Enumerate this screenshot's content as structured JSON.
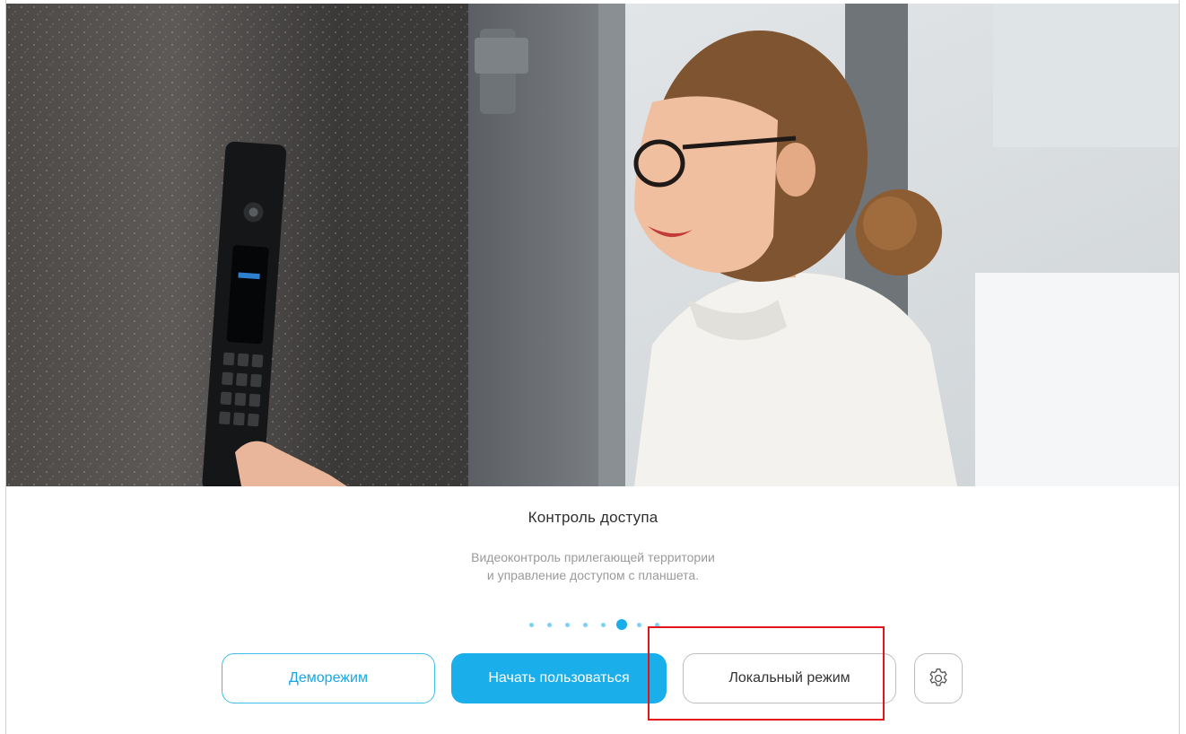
{
  "slide": {
    "title": "Контроль доступа",
    "description_line1": "Видеоконтроль прилегающей территории",
    "description_line2": "и управление доступом с планшета.",
    "total_dots": 8,
    "active_dot_index": 5
  },
  "buttons": {
    "demo_label": "Деморежим",
    "start_label": "Начать пользоваться",
    "local_label": "Локальный режим"
  },
  "icons": {
    "settings": "gear-icon"
  },
  "colors": {
    "accent": "#1aaeea",
    "dot_inactive": "#7fd0f1",
    "highlight": "#e4141b",
    "title_text": "#2f2f2f",
    "description_text": "#9a9a9a"
  }
}
